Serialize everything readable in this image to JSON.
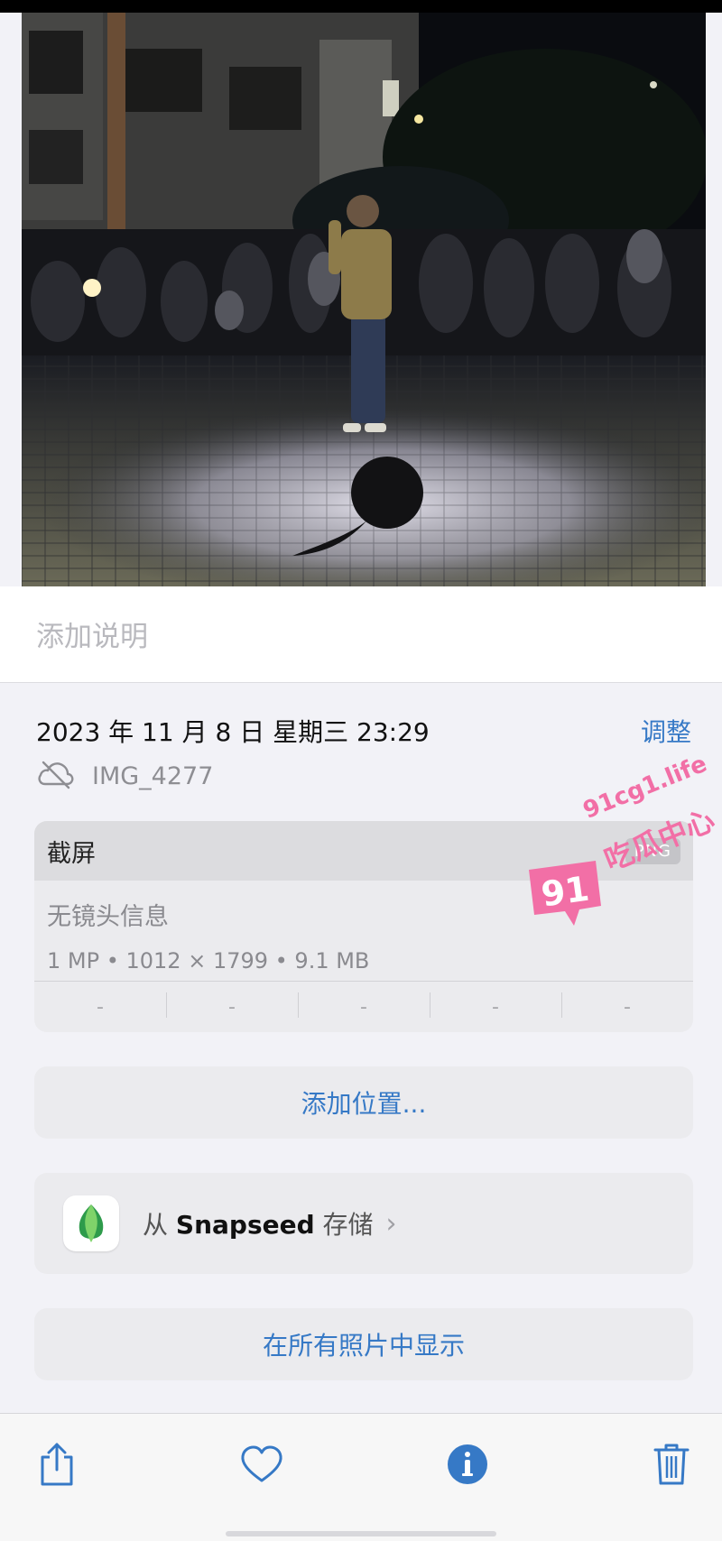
{
  "photo": {
    "subject": "night-photo-man-standing-in-spotlight-crowd"
  },
  "caption": {
    "placeholder": "添加说明"
  },
  "info": {
    "datetime": "2023 年 11 月 8 日  星期三  23:29",
    "adjust_label": "调整",
    "filename": "IMG_4277",
    "cloud_icon": "cloud-slash-icon"
  },
  "metadata": {
    "title": "截屏",
    "format_badge": "PNG",
    "lens": "无镜头信息",
    "specs": "1 MP  •  1012 × 1799  •  9.1 MB",
    "exif_cells": [
      "-",
      "-",
      "-",
      "-",
      "-"
    ]
  },
  "actions": {
    "add_location": "添加位置...",
    "snapseed_prefix": "从 ",
    "snapseed_app": "Snapseed",
    "snapseed_suffix": " 存储",
    "snapseed_chevron": "›",
    "show_in_all_photos": "在所有照片中显示"
  },
  "toolbar": {
    "items": [
      "share-icon",
      "heart-icon",
      "info-icon",
      "trash-icon"
    ]
  },
  "watermark": {
    "site": "91cg1.life",
    "name": "吃瓜中心",
    "number": "91"
  },
  "colors": {
    "accent": "#3679c6",
    "background": "#f2f2f7",
    "watermark": "#f26fa6"
  }
}
